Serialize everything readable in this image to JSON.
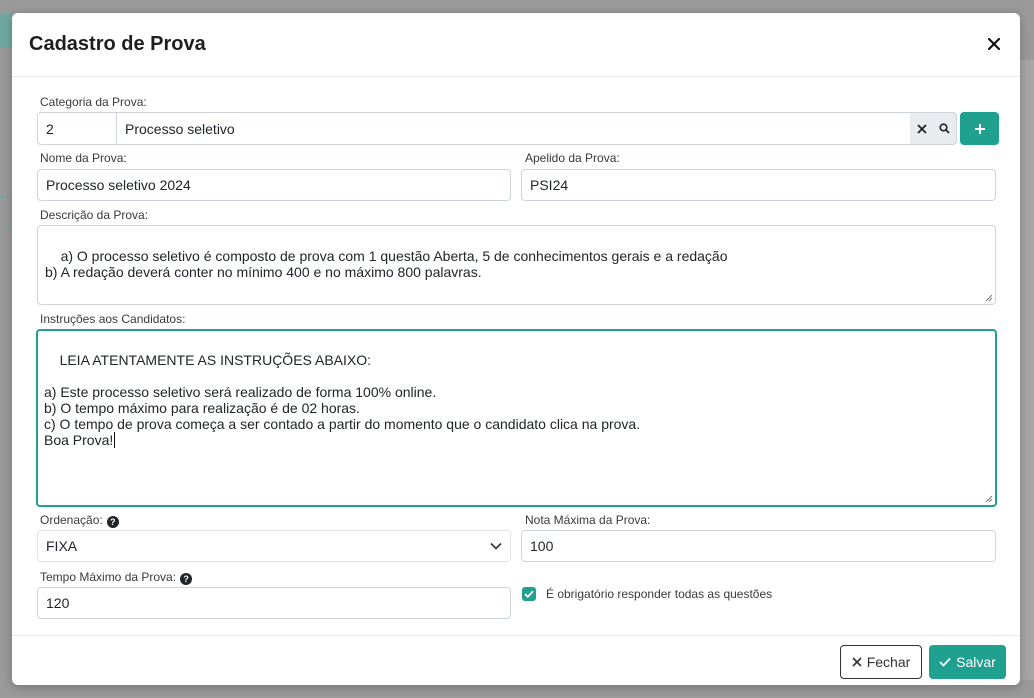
{
  "modal": {
    "title": "Cadastro de Prova",
    "close_glyph": "✕"
  },
  "form": {
    "categoria": {
      "label": "Categoria da Prova:",
      "code": "2",
      "name": "Processo seletivo"
    },
    "nome": {
      "label": "Nome da Prova:",
      "value": "Processo seletivo 2024"
    },
    "apelido": {
      "label": "Apelido da Prova:",
      "value": "PSI24"
    },
    "descricao": {
      "label": "Descrição da Prova:",
      "value": "a) O processo seletivo é composto de prova com 1 questão Aberta, 5 de conhecimentos gerais e a redação\nb) A redação deverá conter no mínimo 400 e no máximo 800 palavras."
    },
    "instrucoes": {
      "label": "Instruções aos Candidatos:",
      "value": "LEIA ATENTAMENTE AS INSTRUÇÕES ABAIXO:\n\na) Este processo seletivo será realizado de forma 100% online.\nb) O tempo máximo para realização é de 02 horas.\nc) O tempo de prova começa a ser contado a partir do momento que o candidato clica na prova.\nBoa Prova!"
    },
    "ordenacao": {
      "label": "Ordenação:",
      "selected": "FIXA"
    },
    "nota_maxima": {
      "label": "Nota Máxima da Prova:",
      "value": "100"
    },
    "tempo_maximo": {
      "label": "Tempo Máximo da Prova:",
      "value": "120"
    },
    "obrigatorio": {
      "label": "É obrigatório responder todas as questões",
      "checked": true
    }
  },
  "footer": {
    "fechar_label": "Fechar",
    "salvar_label": "Salvar"
  },
  "colors": {
    "accent": "#20a08f",
    "help_icon": "#212529"
  }
}
